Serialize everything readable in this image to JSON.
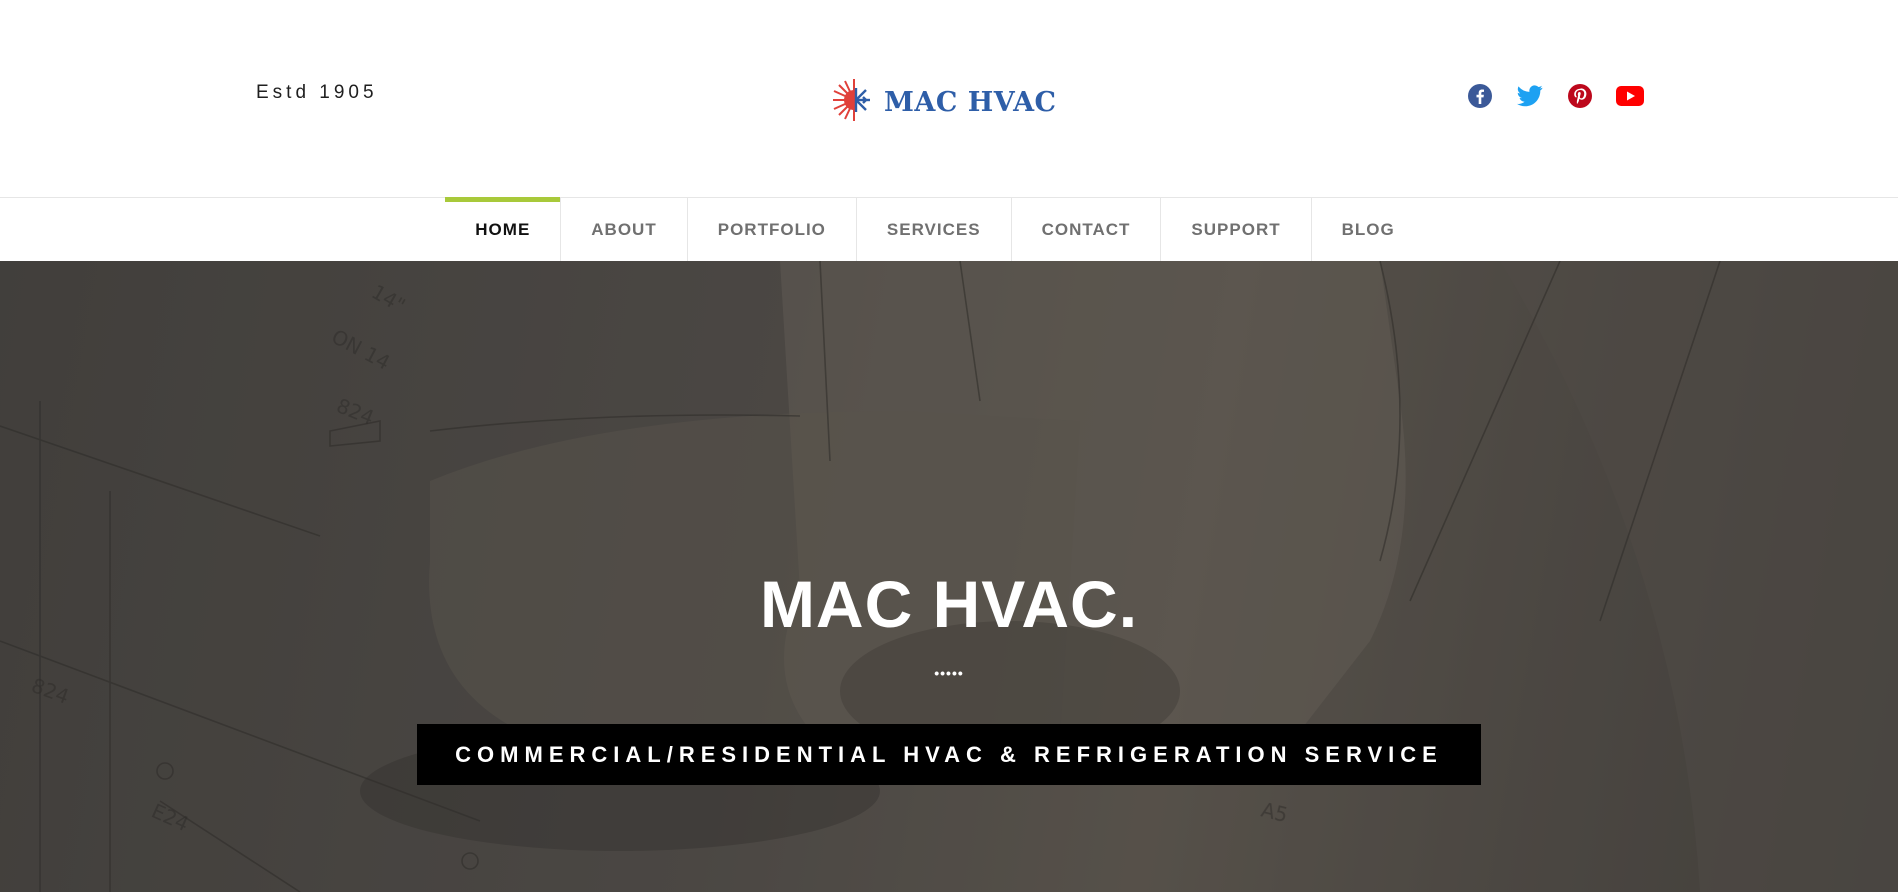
{
  "header": {
    "estd": "Estd 1905",
    "logo_text": "MAC HVAC",
    "socials": [
      {
        "icon": "facebook-icon",
        "color": "#3b5998"
      },
      {
        "icon": "twitter-icon",
        "color": "#1da1f2"
      },
      {
        "icon": "pinterest-icon",
        "color": "#bd081c"
      },
      {
        "icon": "youtube-icon",
        "color": "#ff0000"
      }
    ]
  },
  "nav": {
    "active_color": "#a8c93a",
    "items": [
      {
        "label": "HOME",
        "active": true
      },
      {
        "label": "ABOUT"
      },
      {
        "label": "PORTFOLIO"
      },
      {
        "label": "SERVICES"
      },
      {
        "label": "CONTACT"
      },
      {
        "label": "SUPPORT"
      },
      {
        "label": "BLOG"
      }
    ]
  },
  "hero": {
    "title": "MAC HVAC.",
    "dots": "•••••",
    "tagline": "COMMERCIAL/RESIDENTIAL HVAC & REFRIGERATION SERVICE"
  }
}
